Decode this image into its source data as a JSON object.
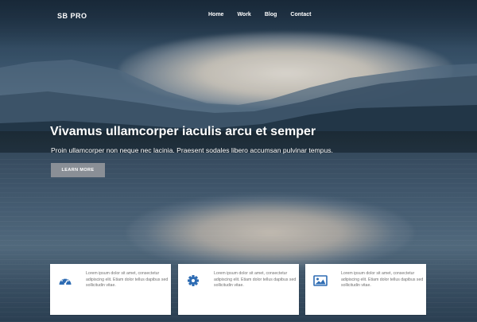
{
  "navbar": {
    "brand": "SB PRO",
    "links": [
      "Home",
      "Work",
      "Blog",
      "Contact"
    ]
  },
  "hero": {
    "title": "Vivamus ullamcorper iaculis arcu et semper",
    "lead": "Proin ullamcorper non neque nec lacinia. Praesent sodales libero accumsan pulvinar tempus.",
    "button_label": "LEARN MORE"
  },
  "features": [
    {
      "icon": "dashboard-icon",
      "text": "Lorem ipsum dolor sit amet, consectetur adipiscing elit. Etiam dolor tellus dapibus sed sollicitudin vitae."
    },
    {
      "icon": "gear-icon",
      "text": "Lorem ipsum dolor sit amet, consectetur adipiscing elit. Etiam dolor tellus dapibus sed sollicitudin vitae."
    },
    {
      "icon": "image-icon",
      "text": "Lorem ipsum dolor sit amet, consectetur adipiscing elit. Etiam dolor tellus dapibus sed sollicitudin vitae."
    }
  ],
  "colors": {
    "icon_accent": "#2e6cb3",
    "button_bg": "#8a8f96"
  }
}
